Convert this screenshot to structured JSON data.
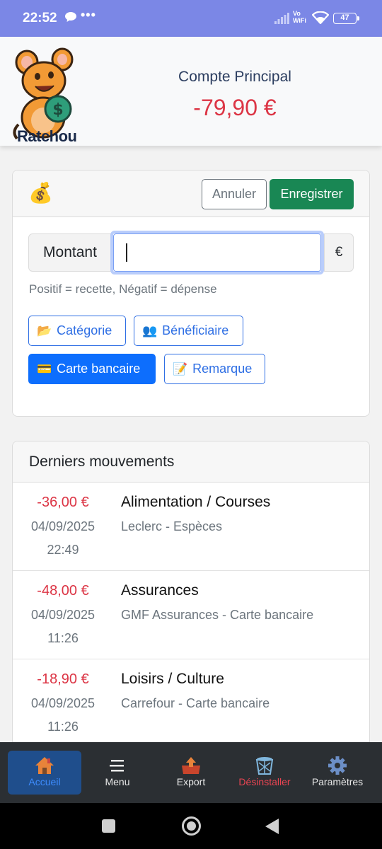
{
  "status_bar": {
    "time": "22:52",
    "dots": "•••",
    "vowifi_line1": "Vo",
    "vowifi_line2": "WiFi",
    "battery": "47"
  },
  "header": {
    "logo_text": "Ratchou",
    "account_name": "Compte Principal",
    "account_balance": "-79,90 €"
  },
  "form": {
    "icon": "moneybag-icon",
    "cancel_label": "Annuler",
    "save_label": "Enregistrer",
    "amount_label": "Montant",
    "amount_value": "",
    "currency": "€",
    "hint": "Positif = recette, Négatif = dépense",
    "chips": [
      {
        "icon": "📂",
        "label": "Catégorie",
        "active": false
      },
      {
        "icon": "👥",
        "label": "Bénéficiaire",
        "active": false
      },
      {
        "icon": "💳",
        "label": "Carte bancaire",
        "active": true
      },
      {
        "icon": "📝",
        "label": "Remarque",
        "active": false
      }
    ]
  },
  "movements": {
    "title": "Derniers mouvements",
    "rows": [
      {
        "amount": "-36,00 €",
        "date": "04/09/2025",
        "time": "22:49",
        "category": "Alimentation / Courses",
        "detail": "Leclerc - Espèces"
      },
      {
        "amount": "-48,00 €",
        "date": "04/09/2025",
        "time": "11:26",
        "category": "Assurances",
        "detail": "GMF Assurances - Carte bancaire"
      },
      {
        "amount": "-18,90 €",
        "date": "04/09/2025",
        "time": "11:26",
        "category": "Loisirs / Culture",
        "detail": "Carrefour - Carte bancaire"
      }
    ]
  },
  "bottom_nav": [
    {
      "label": "Accueil",
      "icon": "home-icon"
    },
    {
      "label": "Menu",
      "icon": "menu-icon"
    },
    {
      "label": "Export",
      "icon": "export-icon"
    },
    {
      "label": "Désinstaller",
      "icon": "trash-icon"
    },
    {
      "label": "Paramètres",
      "icon": "gear-icon"
    }
  ],
  "colors": {
    "status_bar": "#7b87e6",
    "negative": "#dc3545",
    "primary": "#0d6efd",
    "success": "#198754",
    "nav_bg": "#2b2f33"
  }
}
